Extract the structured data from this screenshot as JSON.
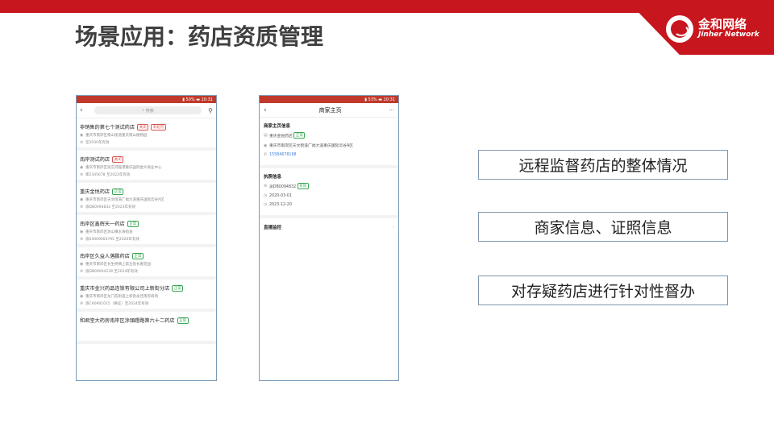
{
  "title": "场景应用：药店资质管理",
  "logo": {
    "cn": "金和网络",
    "en": "Jinher Network"
  },
  "colors": {
    "brand_red": "#c8161e",
    "tag_green": "#3aa655",
    "tag_red": "#d9534f",
    "link_blue": "#3b7fd6"
  },
  "phone1": {
    "status": "▮ 50% ▬ 10:31",
    "search_placeholder": "搜索",
    "stores": [
      {
        "name": "非销售的第七个测试药店",
        "tags": [
          {
            "text": "关闭",
            "color": "red"
          },
          {
            "text": "未处罚",
            "color": "red"
          }
        ],
        "address": "重庆市南岸区南山街道重庆南山植物园",
        "license": "至2030年有效"
      },
      {
        "name": "南岸测试药店",
        "tags": [
          {
            "text": "关闭",
            "color": "red"
          }
        ],
        "address": "重庆市南岸区润沉河临港重庆国际金众商业中心",
        "license": "库2345678 至2022年有效"
      },
      {
        "name": "重庆金悦药店",
        "tags": [
          {
            "text": "正常",
            "color": "green"
          }
        ],
        "address": "重庆市南岸区天文街道广福大道重庆国际云谷A区",
        "license": "渝DB0094832 至2023年有效"
      },
      {
        "name": "南岸区鑫辉天一药店",
        "tags": [
          {
            "text": "正常",
            "color": "green"
          }
        ],
        "address": "重庆市南岸区涂山镇东海街道",
        "license": "渝04009004795 至2020年有效"
      },
      {
        "name": "南岸区久益人落鹏药店",
        "tags": [
          {
            "text": "正常",
            "color": "green"
          }
        ],
        "address": "重庆市南岸区长生桥镇上第五街长嘉花园",
        "license": "渝DB09004238 至2024年有效"
      },
      {
        "name": "重庆市金兴药品连锁有限公司上新街分店",
        "tags": [
          {
            "text": "正常",
            "color": "green"
          }
        ],
        "address": "重庆市南岸区龙门浩街道上新街永佳南岸商场",
        "license": "渝CA0901015（换证）至2024年有效"
      },
      {
        "name": "和君堂大药房南岸区涂頭蹬路第六十二药店",
        "tags": [
          {
            "text": "正常",
            "color": "green"
          }
        ],
        "address": "",
        "license": ""
      }
    ]
  },
  "phone2": {
    "status": "▮ 53% ▬ 10:31",
    "nav_title": "商家主页",
    "more": "···",
    "merchant_section_title": "商家主页信息",
    "merchant_name": "重庆金悦药店",
    "merchant_tag": "正常",
    "merchant_address": "重庆市南岸区天文街道广福大道重庆国际云谷A区",
    "merchant_phone": "15584678168",
    "license_section_title": "执照信息",
    "license_no": "渝DB0094832",
    "license_tag": "有效",
    "license_start": "2020-03-01",
    "license_end": "2023-12-20",
    "live_label": "直播监控",
    "live_arrow": "›"
  },
  "boxes": [
    "远程监督药店的整体情况",
    "商家信息、证照信息",
    "对存疑药店进行针对性督办"
  ]
}
